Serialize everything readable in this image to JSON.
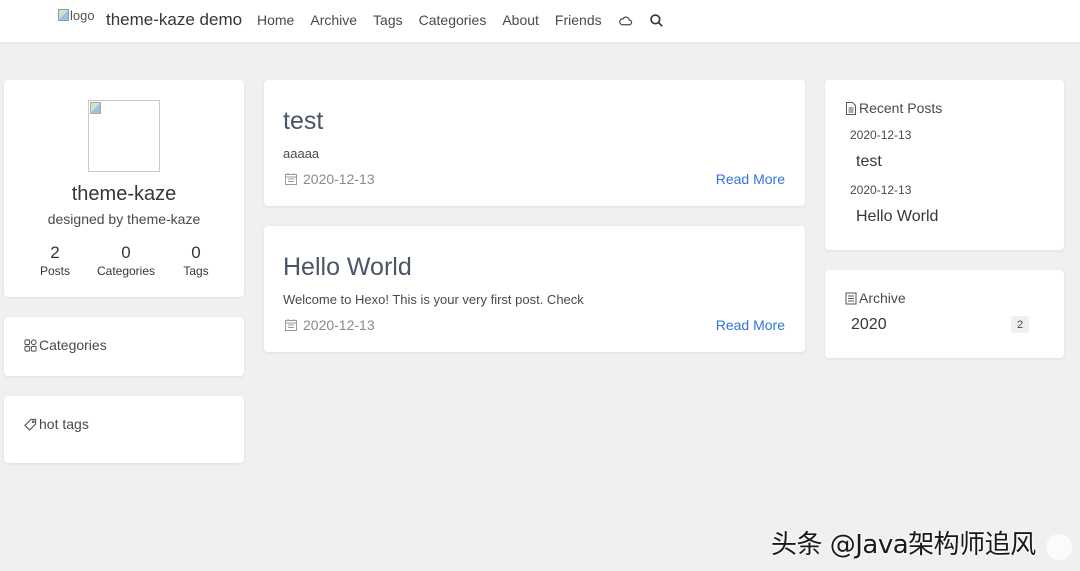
{
  "navbar": {
    "logo_alt": "logo",
    "brand": "theme-kaze demo",
    "items": [
      {
        "label": "Home"
      },
      {
        "label": "Archive"
      },
      {
        "label": "Tags"
      },
      {
        "label": "Categories"
      },
      {
        "label": "About"
      },
      {
        "label": "Friends"
      }
    ],
    "icons": [
      "cloud-icon",
      "search-icon"
    ]
  },
  "profile": {
    "name": "theme-kaze",
    "description": "designed by theme-kaze",
    "stats": [
      {
        "value": "2",
        "label": "Posts"
      },
      {
        "value": "0",
        "label": "Categories"
      },
      {
        "value": "0",
        "label": "Tags"
      }
    ]
  },
  "categories_card": {
    "title": "Categories"
  },
  "tags_card": {
    "title": "hot tags"
  },
  "posts": [
    {
      "title": "test",
      "excerpt": "aaaaa",
      "date": "2020-12-13",
      "read_more": "Read More"
    },
    {
      "title": "Hello World",
      "excerpt": "Welcome to Hexo! This is your very first post. Check",
      "date": "2020-12-13",
      "read_more": "Read More"
    }
  ],
  "recent_posts": {
    "title": "Recent Posts",
    "items": [
      {
        "date": "2020-12-13",
        "title": "test"
      },
      {
        "date": "2020-12-13",
        "title": "Hello World"
      }
    ]
  },
  "archive": {
    "title": "Archive",
    "items": [
      {
        "year": "2020",
        "count": "2"
      }
    ]
  },
  "watermark": "头条 @Java架构师追风",
  "colors": {
    "link": "#3273dc",
    "background": "#f0f0f3",
    "card": "#ffffff"
  }
}
